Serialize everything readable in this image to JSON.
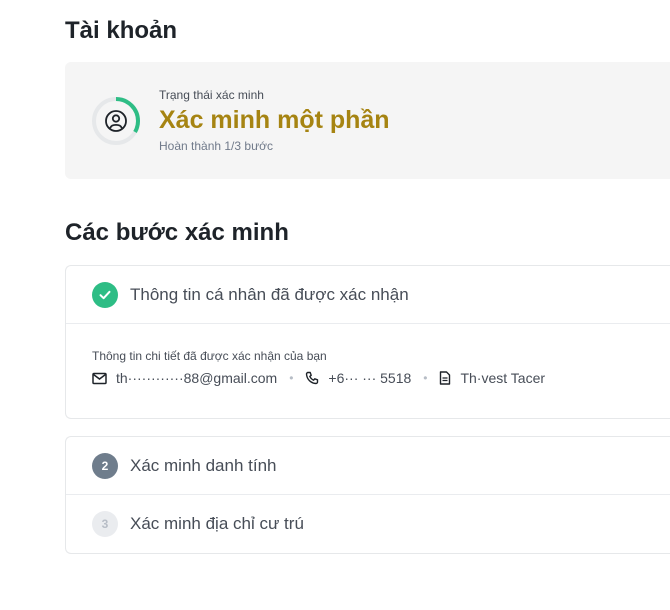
{
  "page": {
    "title": "Tài khoản"
  },
  "status": {
    "label": "Trạng thái xác minh",
    "value": "Xác minh một phần",
    "progress_text": "Hoàn thành 1/3 bước",
    "progress_fraction": 0.333,
    "icon": "user-circle-icon",
    "colors": {
      "value": "#a68412",
      "ring_done": "#2ebd85",
      "ring_track": "#e6e8ea"
    }
  },
  "steps_section": {
    "title": "Các bước xác minh",
    "steps": [
      {
        "number": "",
        "label": "Thông tin cá nhân đã được xác nhận",
        "state": "done",
        "icon": "check-icon",
        "detail": {
          "caption": "Thông tin chi tiết đã được xác nhận của bạn",
          "email": "th············88@gmail.com",
          "phone": "+6··· ··· 5518",
          "name": "Th·vest Tacer",
          "separator": "•",
          "icons": [
            "mail-icon",
            "phone-icon",
            "document-icon"
          ]
        }
      },
      {
        "number": "2",
        "label": "Xác minh danh tính",
        "state": "active"
      },
      {
        "number": "3",
        "label": "Xác minh địa chỉ cư trú",
        "state": "inactive"
      }
    ]
  },
  "colors": {
    "done": "#2ebd85",
    "active": "#6f7d8c",
    "inactive": "#eaecef"
  }
}
